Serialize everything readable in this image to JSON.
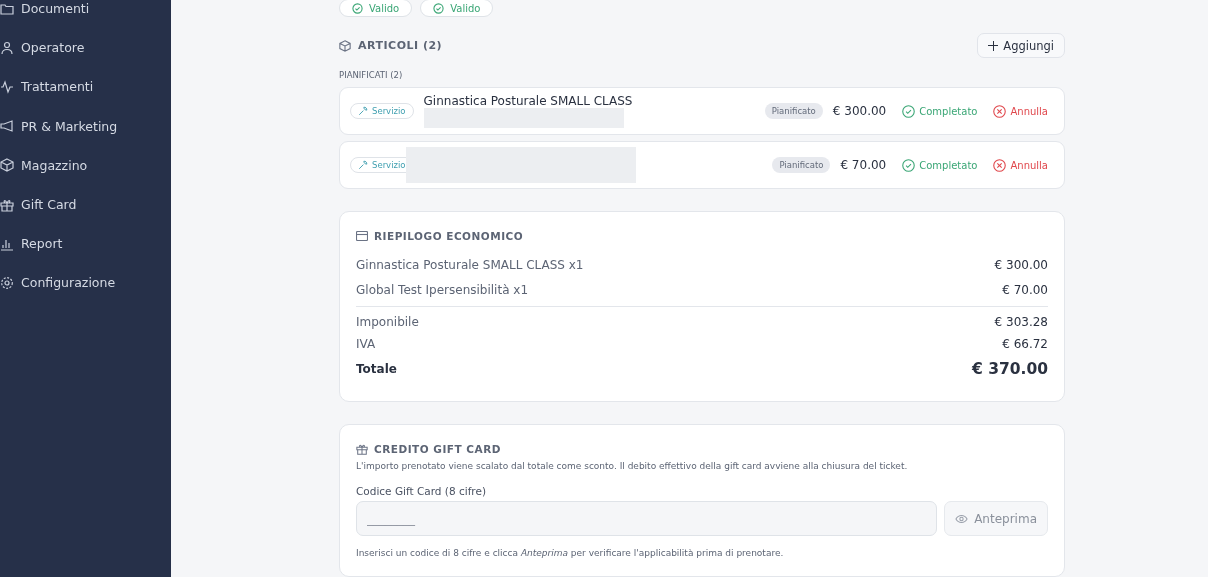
{
  "sidebar": {
    "items": [
      {
        "label": "Documenti"
      },
      {
        "label": "Operatore"
      },
      {
        "label": "Trattamenti"
      },
      {
        "label": "PR & Marketing"
      },
      {
        "label": "Magazzino"
      },
      {
        "label": "Gift Card"
      },
      {
        "label": "Report"
      },
      {
        "label": "Configurazione"
      }
    ]
  },
  "validity_badges": [
    "Valido",
    "Valido"
  ],
  "articles": {
    "title": "ARTICOLI (2)",
    "add_button": "Aggiungi",
    "group_label": "PIANIFICATI (2)",
    "items": [
      {
        "type_badge": "Servizio",
        "name": "Ginnastica Posturale SMALL CLASS",
        "status": "Pianificato",
        "price": "€ 300.00",
        "complete": "Completato",
        "cancel": "Annulla"
      },
      {
        "type_badge": "Servizio",
        "status": "Pianificato",
        "price": "€ 70.00",
        "complete": "Completato",
        "cancel": "Annulla"
      }
    ]
  },
  "summary": {
    "title": "RIEPILOGO ECONOMICO",
    "lines": [
      {
        "label": "Ginnastica Posturale SMALL CLASS x1",
        "value": "€ 300.00"
      },
      {
        "label": "Global Test Ipersensibilità x1",
        "value": "€ 70.00"
      }
    ],
    "totals": [
      {
        "kind": "plain",
        "label": "Imponibile",
        "value": "€ 303.28"
      },
      {
        "kind": "plain",
        "label": "IVA",
        "value": "€ 66.72"
      },
      {
        "kind": "total",
        "label": "Totale",
        "value": "€ 370.00"
      }
    ]
  },
  "gift_card": {
    "title": "CREDITO GIFT CARD",
    "description": "L'importo prenotato viene scalato dal totale come sconto. Il debito effettivo della gift card avviene alla chiusura del ticket.",
    "field_label": "Codice Gift Card (8 cifre)",
    "placeholder": "________",
    "preview_button": "Anteprima",
    "hint": "Inserisci un codice di 8 cifre e clicca *Anteprima* per verificare l'applicabilità prima di prenotare."
  }
}
